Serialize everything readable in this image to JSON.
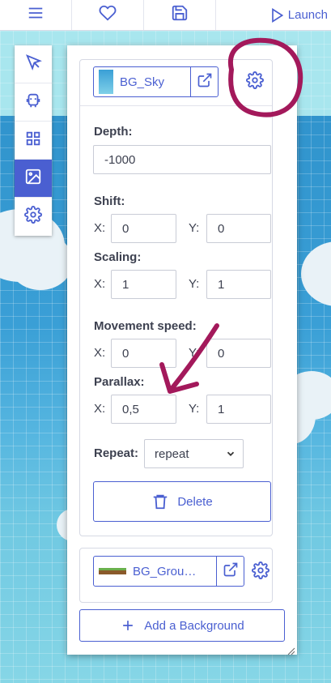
{
  "toolbar": {
    "menu_icon": "hamburger-menu-icon",
    "favorite_icon": "heart-icon",
    "save_icon": "floppy-disk-icon",
    "launch_label": "Launch",
    "launch_icon": "play-triangle-icon"
  },
  "palette": {
    "items": [
      {
        "icon": "cursor-arrow-icon",
        "active": false
      },
      {
        "icon": "robot-icon",
        "active": false
      },
      {
        "icon": "grid-tiles-icon",
        "active": false
      },
      {
        "icon": "image-icon",
        "active": true
      },
      {
        "icon": "gear-icon",
        "active": false
      }
    ]
  },
  "background_sky": {
    "name": "BG_Sky",
    "depth_label": "Depth:",
    "depth_value": "-1000",
    "shift_label": "Shift:",
    "shift_x_label": "X:",
    "shift_x": "0",
    "shift_y_label": "Y:",
    "shift_y": "0",
    "scaling_label": "Scaling:",
    "scaling_x_label": "X:",
    "scaling_x": "1",
    "scaling_y_label": "Y:",
    "scaling_y": "1",
    "movement_label": "Movement speed:",
    "movement_x_label": "X:",
    "movement_x": "0",
    "movement_y_label": "Y:",
    "movement_y": "0",
    "parallax_label": "Parallax:",
    "parallax_x_label": "X:",
    "parallax_x": "0,5",
    "parallax_y_label": "Y:",
    "parallax_y": "1",
    "repeat_label": "Repeat:",
    "repeat_value": "repeat",
    "delete_label": "Delete"
  },
  "background_ground": {
    "name": "BG_Grou…"
  },
  "add_background_label": "Add a Background",
  "colors": {
    "accent": "#4a5fd1",
    "annotation": "#a3195b",
    "sky": "#3a9fd6"
  }
}
